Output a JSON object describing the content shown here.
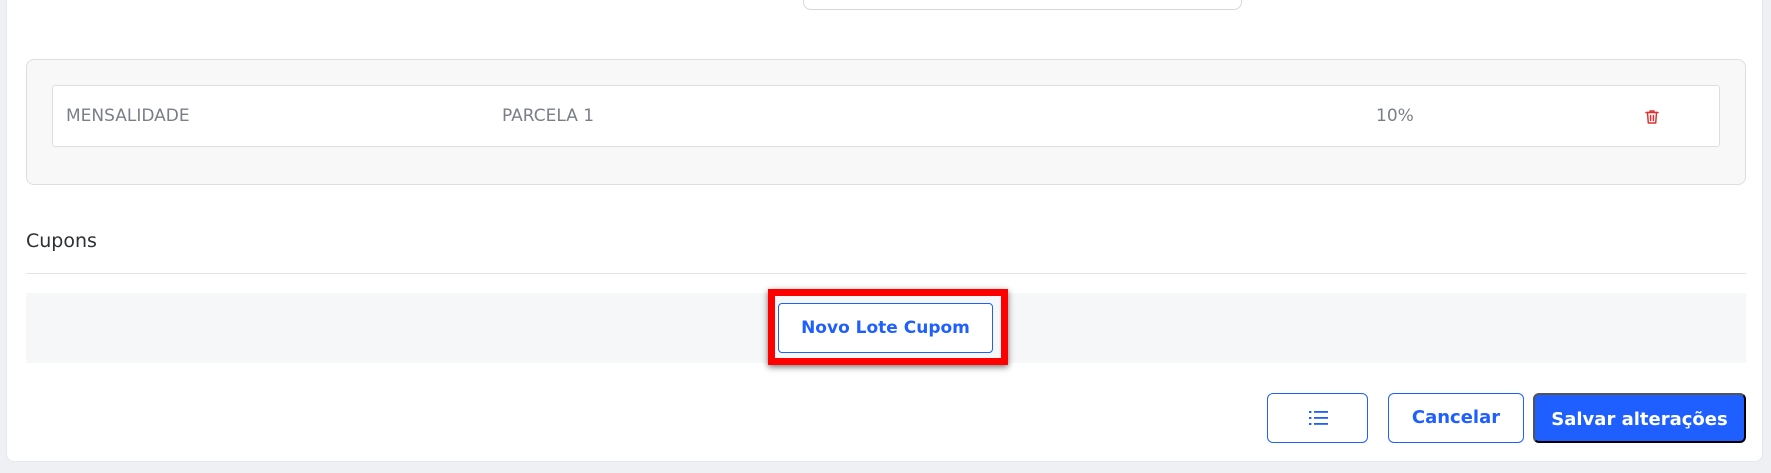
{
  "discounts": {
    "rows": [
      {
        "type": "MENSALIDADE",
        "installment": "PARCELA 1",
        "percent": "10%",
        "delete_icon": "trash-icon"
      }
    ]
  },
  "coupons": {
    "section_title": "Cupons",
    "new_lot_button": "Novo Lote Cupom"
  },
  "footer": {
    "list_icon": "list-icon",
    "cancel_label": "Cancelar",
    "save_label": "Salvar alterações"
  },
  "colors": {
    "accent": "#1f5fff",
    "danger": "#e03131",
    "highlight": "#ff0000"
  }
}
